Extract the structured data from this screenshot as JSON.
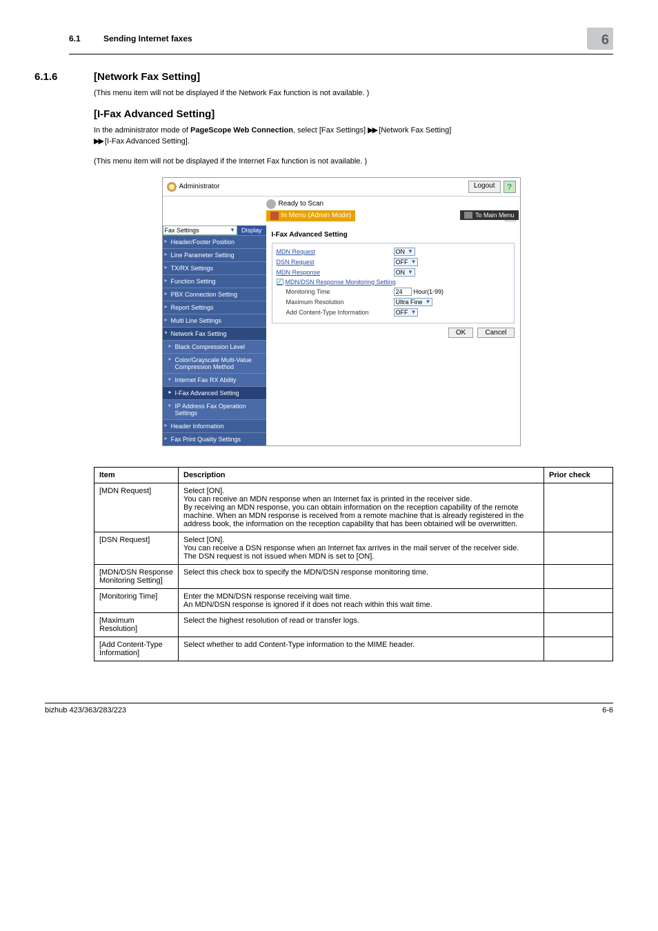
{
  "page": {
    "section_number_small": "6.1",
    "section_title_small": "Sending Internet faxes",
    "corner_badge": "6",
    "heading_number": "6.1.6",
    "heading_title": "[Network Fax Setting]",
    "intro_1": "(This menu item will not be displayed if the Network Fax function is not available. )",
    "subheading": "[I-Fax Advanced Setting]",
    "intro_2a": "In the administrator mode of ",
    "intro_2_bold": "PageScope Web Connection",
    "intro_2b": ", select [Fax Settings] ",
    "arrow": "▶▶",
    "intro_2c": " [Network Fax Setting] ",
    "intro_2d": " [I-Fax Advanced Setting].",
    "intro_3": "(This menu item will not be displayed if the Internet Fax function is not available. )",
    "footer_left": "bizhub 423/363/283/223",
    "footer_right": "6-6"
  },
  "screenshot": {
    "administrator": "Administrator",
    "logout": "Logout",
    "help": "?",
    "ready": "Ready to Scan",
    "menu_mode": "In Menu (Admin Mode)",
    "refresh_glyph": "↻",
    "select_value": "Fax Settings",
    "display_btn": "Display",
    "to_main_menu": "To Main Menu",
    "nav": {
      "i0": "Header/Footer Position",
      "i1": "Line Parameter Setting",
      "i2": "TX/RX Settings",
      "i3": "Function Setting",
      "i4": "PBX Connection Setting",
      "i5": "Report Settings",
      "i6": "Multi Line Settings",
      "i7": "Network Fax Setting",
      "s0": "Black Compression Level",
      "s1": "Color/Grayscale Multi-Value Compression Method",
      "s2": "Internet Fax RX Ability",
      "s3": "I-Fax Advanced Setting",
      "s4": "IP Address Fax Operation Settings",
      "i8": "Header Information",
      "i9": "Fax Print Quality Settings"
    },
    "content": {
      "heading": "I-Fax Advanced Setting",
      "mdn_request": "MDN Request",
      "mdn_request_val": "ON",
      "dsn_request": "DSN Request",
      "dsn_request_val": "OFF",
      "mdn_response": "MDN Response",
      "mdn_response_val": "ON",
      "check_label": "MDN/DSN Response Monitoring Setting",
      "check_mark": "✓",
      "monitoring_time": "Monitoring Time",
      "monitoring_val": "24",
      "monitoring_suffix": "Hour(1-99)",
      "max_res": "Maximum Resolution",
      "max_res_val": "Ultra Fine",
      "add_ct": "Add Content-Type Information",
      "add_ct_val": "OFF",
      "ok": "OK",
      "cancel": "Cancel"
    }
  },
  "table": {
    "h_item": "Item",
    "h_desc": "Description",
    "h_prior": "Prior check",
    "r1_item": "[MDN Request]",
    "r1_desc": "Select [ON].\nYou can receive an MDN response when an Internet fax is printed in the receiver side.\nBy receiving an MDN response, you can obtain information on the reception capability of the remote machine. When an MDN response is received from a remote machine that is already registered in the address book, the information on the reception capability that has been obtained will be overwritten.",
    "r2_item": "[DSN Request]",
    "r2_desc": "Select [ON].\nYou can receive a DSN response when an Internet fax arrives in the mail server of the receiver side.\nThe DSN request is not issued when MDN is set to [ON].",
    "r3_item": "[MDN/DSN Response Monitoring Setting]",
    "r3_desc": "Select this check box to specify the MDN/DSN response monitoring time.",
    "r4_item": "[Monitoring Time]",
    "r4_desc": "Enter the MDN/DSN response receiving wait time.\nAn MDN/DSN response is ignored if it does not reach within this wait time.",
    "r5_item": "[Maximum Resolution]",
    "r5_desc": "Select the highest resolution of read or transfer logs.",
    "r6_item": "[Add Content-Type Information]",
    "r6_desc": "Select whether to add Content-Type information to the MIME header."
  }
}
